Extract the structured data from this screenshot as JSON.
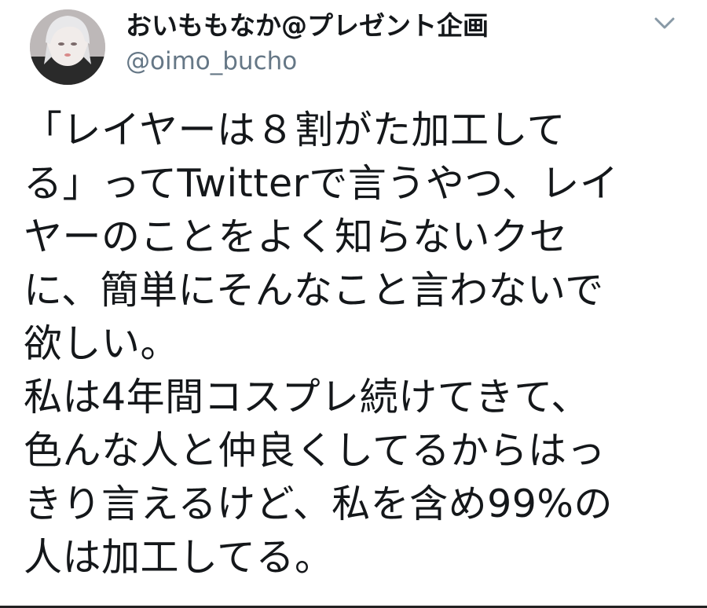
{
  "tweet": {
    "display_name": "おいももなか@プレゼント企画",
    "handle": "@oimo_bucho",
    "menu_icon": "chevron-down-icon",
    "body_lines": [
      "「レイヤーは８割がた加工して",
      "る」ってTwitterで言うやつ、レイ",
      "ヤーのことをよく知らないクセ",
      "に、簡単にそんなこと言わないで",
      "欲しい。",
      " 私は4年間コスプレ続けてきて、",
      "色んな人と仲良くしてるからはっ",
      "きり言えるけど、私を含め99%の",
      "人は加工してる。"
    ]
  },
  "colors": {
    "text": "#14171a",
    "secondary": "#657786",
    "background": "#ffffff"
  }
}
